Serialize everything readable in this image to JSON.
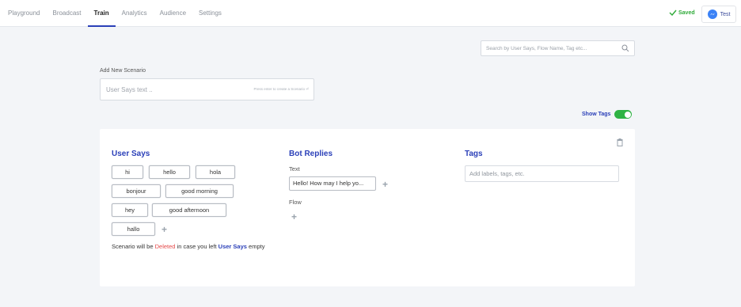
{
  "nav": {
    "tabs": [
      {
        "label": "Playground"
      },
      {
        "label": "Broadcast"
      },
      {
        "label": "Train"
      },
      {
        "label": "Analytics"
      },
      {
        "label": "Audience"
      },
      {
        "label": "Settings"
      }
    ],
    "active_tab": "Train",
    "saved_label": "Saved",
    "test_label": "Test"
  },
  "search": {
    "placeholder": "Search by User Says, Flow Name, Tag etc..."
  },
  "add_scenario": {
    "label": "Add New Scenario",
    "placeholder": "User Says text ..",
    "hint": "Press enter to create a Scenario ⏎"
  },
  "show_tags": {
    "label": "Show Tags",
    "enabled": true
  },
  "scenario": {
    "user_says_title": "User Says",
    "user_says": [
      "hi",
      "hello",
      "hola",
      "bonjour",
      "good morning",
      "hey",
      "good afternoon",
      "hallo"
    ],
    "note": {
      "prefix": "Scenario will be ",
      "deleted": "Deleted",
      "middle": " in case you left ",
      "user_says": "User Says",
      "suffix": " empty"
    },
    "bot_replies_title": "Bot Replies",
    "text_label": "Text",
    "reply_text": "Hello! How may I help yo...",
    "flow_label": "Flow",
    "tags_title": "Tags",
    "tags_placeholder": "Add labels, tags, etc."
  },
  "colors": {
    "accent": "#2a3fb8",
    "success": "#2fb344",
    "danger": "#e54b4b",
    "messenger": "#3b82f6"
  }
}
